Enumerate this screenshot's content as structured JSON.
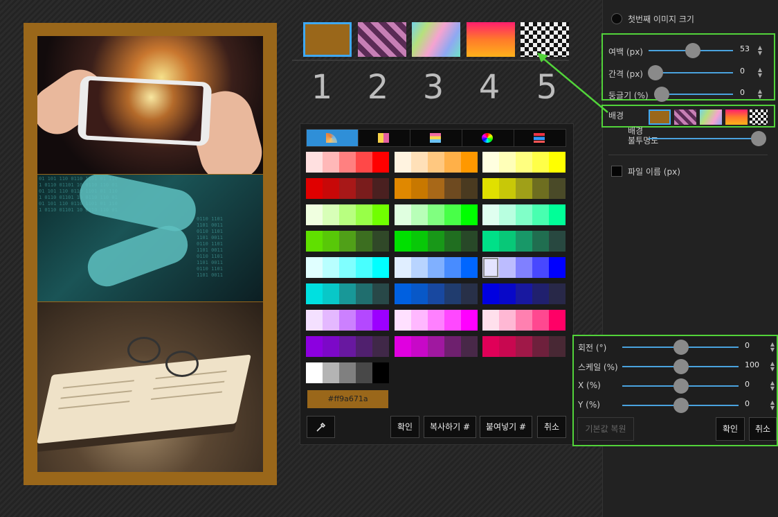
{
  "swatches": {
    "numbers": [
      "1",
      "2",
      "3",
      "4",
      "5"
    ],
    "colors": {
      "solid": "#9a671a"
    }
  },
  "picker": {
    "tabs": [
      "gradient-fan-icon",
      "palette-grid-icon",
      "color-bars-icon",
      "color-wheel-icon",
      "sliders-icon"
    ],
    "groups": [
      [
        "#ffe0e0",
        "#ffb8b8",
        "#ff8080",
        "#ff4848",
        "#ff0000"
      ],
      [
        "#fff3e0",
        "#ffe0b8",
        "#ffc880",
        "#ffb048",
        "#ff9800"
      ],
      [
        "#ffffe0",
        "#ffffb8",
        "#ffff80",
        "#ffff48",
        "#ffff00"
      ],
      [
        "#e00000",
        "#c80808",
        "#a81818",
        "#7a1c1c",
        "#4a2020"
      ],
      [
        "#e08800",
        "#c87800",
        "#a86818",
        "#6e4a20",
        "#4a3a20"
      ],
      [
        "#e0e000",
        "#c8c808",
        "#a0a018",
        "#6e6e20",
        "#4a4a28"
      ],
      [
        "#f0ffe0",
        "#d8ffb8",
        "#b8ff80",
        "#98ff48",
        "#70ff00"
      ],
      [
        "#e0ffe0",
        "#b8ffb8",
        "#80ff80",
        "#48ff48",
        "#00ff00"
      ],
      [
        "#e0fff0",
        "#b8ffe0",
        "#80ffc8",
        "#48ffb0",
        "#00ff98"
      ],
      [
        "#60e000",
        "#58c808",
        "#50a018",
        "#3c6e20",
        "#304828"
      ],
      [
        "#00e000",
        "#08c808",
        "#189818",
        "#206e20",
        "#284828"
      ],
      [
        "#00e088",
        "#08c878",
        "#189868",
        "#206e50",
        "#284840"
      ],
      [
        "#e0ffff",
        "#b8ffff",
        "#80ffff",
        "#48ffff",
        "#00ffff"
      ],
      [
        "#e0eeff",
        "#b8d4ff",
        "#80b0ff",
        "#488cff",
        "#0066ff"
      ],
      [
        "#e4e4ff",
        "#bcbcff",
        "#8080ff",
        "#4848ff",
        "#0000ff"
      ],
      [
        "#00e0e0",
        "#08c8c8",
        "#189898",
        "#206e6e",
        "#284848"
      ],
      [
        "#0060e0",
        "#0858c8",
        "#1848a0",
        "#203c6e",
        "#283048"
      ],
      [
        "#0000e0",
        "#0808c8",
        "#1818a0",
        "#20206e",
        "#282848"
      ],
      [
        "#f4e0ff",
        "#e4b8ff",
        "#cc80ff",
        "#b448ff",
        "#9c00ff"
      ],
      [
        "#ffe0ff",
        "#ffb8ff",
        "#ff80ff",
        "#ff48ff",
        "#ff00ff"
      ],
      [
        "#ffe0ec",
        "#ffb8d4",
        "#ff80b0",
        "#ff4890",
        "#ff0066"
      ],
      [
        "#8c00e0",
        "#7c08c8",
        "#6818a0",
        "#50206e",
        "#402848"
      ],
      [
        "#e000e0",
        "#c808c8",
        "#a018a0",
        "#6e206e",
        "#482848"
      ],
      [
        "#e00058",
        "#c80850",
        "#a01848",
        "#6e203c",
        "#482834"
      ],
      [
        "#ffffff",
        "#b4b4b4",
        "#808080",
        "#484848",
        "#000000"
      ]
    ],
    "hex_value": "#ff9a671a",
    "eyedropper_icon": "eyedropper-icon",
    "buttons": {
      "confirm": "확인",
      "copy": "복사하기 #",
      "paste": "붙여넣기 #",
      "cancel": "취소"
    }
  },
  "panel": {
    "first_image_size": "첫번째 이미지 크기",
    "margin": {
      "label": "여백 (px)",
      "value": "53",
      "level": 0.53
    },
    "gap": {
      "label": "간격 (px)",
      "value": "0",
      "level": 0
    },
    "roundness": {
      "label": "둥글기 (%)",
      "value": "0",
      "level": 0
    },
    "background_label": "배경",
    "bg_opacity_label": "배경\n불투명도",
    "bg_opacity_level": 1.0,
    "filename_label": "파일 이름 (px)"
  },
  "transform": {
    "rotation": {
      "label": "회전 (°)",
      "value": "0"
    },
    "scale": {
      "label": "스케일 (%)",
      "value": "100"
    },
    "x": {
      "label": "X (%)",
      "value": "0"
    },
    "y": {
      "label": "Y (%)",
      "value": "0"
    },
    "reset": "기본값 복원",
    "confirm": "확인",
    "cancel": "취소"
  }
}
